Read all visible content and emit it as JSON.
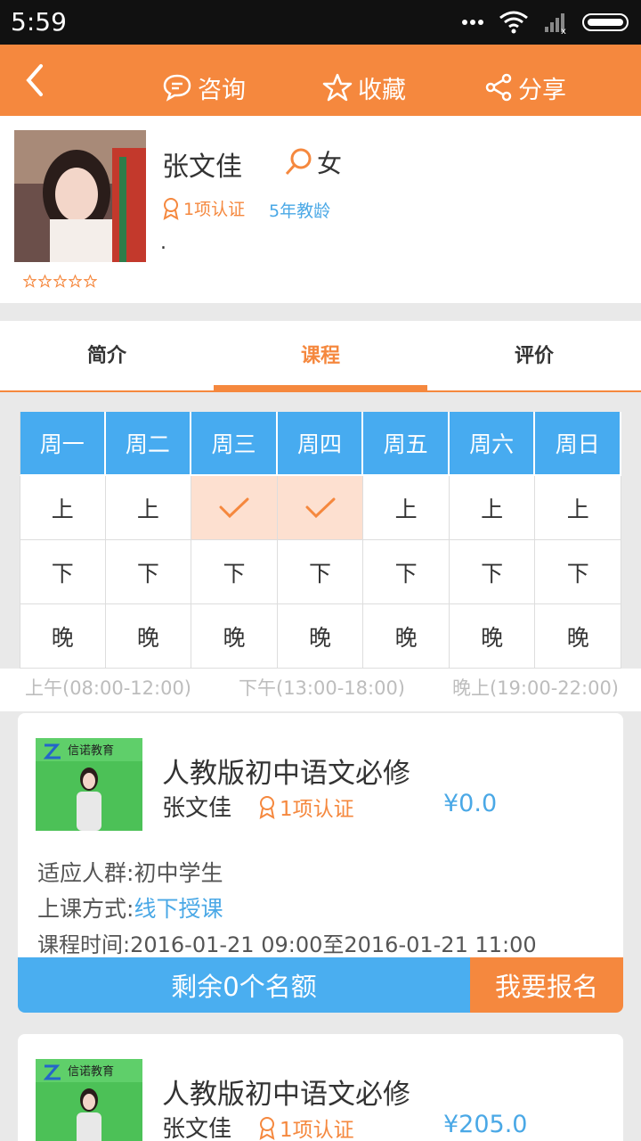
{
  "status_bar": {
    "time": "5:59"
  },
  "nav": {
    "consult": "咨询",
    "favorite": "收藏",
    "share": "分享"
  },
  "profile": {
    "name": "张文佳",
    "gender": "女",
    "certification": "1项认证",
    "teaching_years": "5年教龄",
    "description": ".",
    "rating": 0
  },
  "tabs": [
    {
      "label": "简介"
    },
    {
      "label": "课程"
    },
    {
      "label": "评价"
    }
  ],
  "schedule": {
    "days": [
      "周一",
      "周二",
      "周三",
      "周四",
      "周五",
      "周六",
      "周日"
    ],
    "rows": [
      {
        "label": "上",
        "checked": [
          false,
          false,
          true,
          true,
          false,
          false,
          false
        ]
      },
      {
        "label": "下",
        "checked": [
          false,
          false,
          false,
          false,
          false,
          false,
          false
        ]
      },
      {
        "label": "晚",
        "checked": [
          false,
          false,
          false,
          false,
          false,
          false,
          false
        ]
      }
    ],
    "legend": [
      "上午(08:00-12:00)",
      "下午(13:00-18:00)",
      "晚上(19:00-22:00)"
    ]
  },
  "courses": [
    {
      "thumb_text": "信诺教育",
      "title": "人教版初中语文必修",
      "teacher": "张文佳",
      "certification": "1项认证",
      "price": "¥0.0",
      "audience_label": "适应人群:",
      "audience": "初中学生",
      "mode_label": "上课方式:",
      "mode": "线下授课",
      "time_label": "课程时间:",
      "time": "2016-01-21 09:00至2016-01-21 11:00",
      "remaining": "剩余0个名额",
      "signup": "我要报名"
    },
    {
      "thumb_text": "信诺教育",
      "title": "人教版初中语文必修",
      "teacher": "张文佳",
      "certification": "1项认证",
      "price": "¥205.0"
    }
  ],
  "colors": {
    "accent": "#f5883e",
    "blue": "#4aa8e6",
    "header_blue": "#47abf0"
  }
}
